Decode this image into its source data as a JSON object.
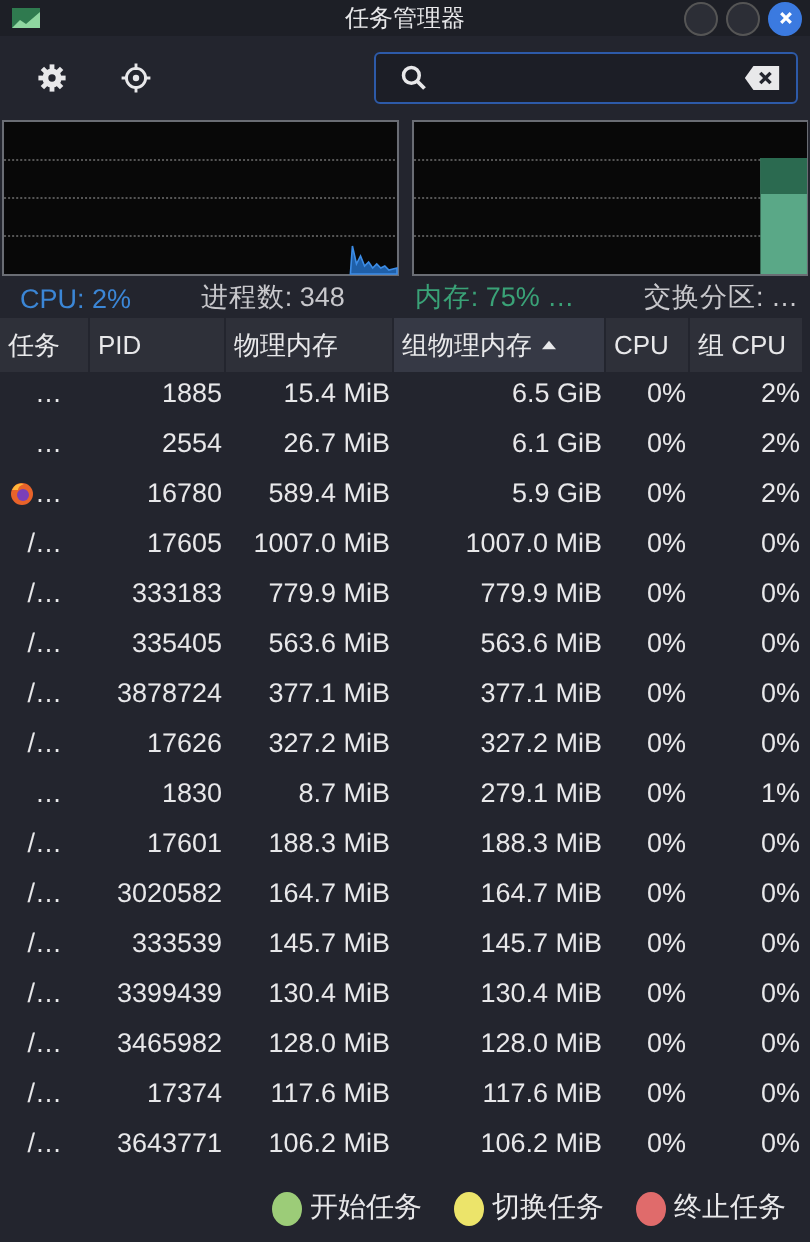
{
  "window": {
    "title": "任务管理器"
  },
  "stats": [
    {
      "text": "CPU: 2%",
      "kind": "cpu"
    },
    {
      "text": "进程数: 348",
      "kind": "plain"
    },
    {
      "text": "内存: 75% …",
      "kind": "memory"
    },
    {
      "text": "交换分区: …",
      "kind": "plain"
    }
  ],
  "table": {
    "columns": [
      {
        "label": "任务",
        "sorted": false
      },
      {
        "label": "PID",
        "sorted": false
      },
      {
        "label": "物理内存",
        "sorted": false
      },
      {
        "label": "组物理内存",
        "sorted": true
      },
      {
        "label": "CPU",
        "sorted": false
      },
      {
        "label": "组 CPU",
        "sorted": false
      }
    ],
    "rows": [
      {
        "task": "…",
        "icon": false,
        "pid": "1885",
        "memory": "15.4 MiB",
        "group_memory": "6.5 GiB",
        "cpu": "0%",
        "group_cpu": "2%"
      },
      {
        "task": "…",
        "icon": false,
        "pid": "2554",
        "memory": "26.7 MiB",
        "group_memory": "6.1 GiB",
        "cpu": "0%",
        "group_cpu": "2%"
      },
      {
        "task": "…",
        "icon": true,
        "pid": "16780",
        "memory": "589.4 MiB",
        "group_memory": "5.9 GiB",
        "cpu": "0%",
        "group_cpu": "2%"
      },
      {
        "task": "/…",
        "icon": false,
        "pid": "17605",
        "memory": "1007.0 MiB",
        "group_memory": "1007.0 MiB",
        "cpu": "0%",
        "group_cpu": "0%"
      },
      {
        "task": "/…",
        "icon": false,
        "pid": "333183",
        "memory": "779.9 MiB",
        "group_memory": "779.9 MiB",
        "cpu": "0%",
        "group_cpu": "0%"
      },
      {
        "task": "/…",
        "icon": false,
        "pid": "335405",
        "memory": "563.6 MiB",
        "group_memory": "563.6 MiB",
        "cpu": "0%",
        "group_cpu": "0%"
      },
      {
        "task": "/…",
        "icon": false,
        "pid": "3878724",
        "memory": "377.1 MiB",
        "group_memory": "377.1 MiB",
        "cpu": "0%",
        "group_cpu": "0%"
      },
      {
        "task": "/…",
        "icon": false,
        "pid": "17626",
        "memory": "327.2 MiB",
        "group_memory": "327.2 MiB",
        "cpu": "0%",
        "group_cpu": "0%"
      },
      {
        "task": "…",
        "icon": false,
        "pid": "1830",
        "memory": "8.7 MiB",
        "group_memory": "279.1 MiB",
        "cpu": "0%",
        "group_cpu": "1%"
      },
      {
        "task": "/…",
        "icon": false,
        "pid": "17601",
        "memory": "188.3 MiB",
        "group_memory": "188.3 MiB",
        "cpu": "0%",
        "group_cpu": "0%"
      },
      {
        "task": "/…",
        "icon": false,
        "pid": "3020582",
        "memory": "164.7 MiB",
        "group_memory": "164.7 MiB",
        "cpu": "0%",
        "group_cpu": "0%"
      },
      {
        "task": "/…",
        "icon": false,
        "pid": "333539",
        "memory": "145.7 MiB",
        "group_memory": "145.7 MiB",
        "cpu": "0%",
        "group_cpu": "0%"
      },
      {
        "task": "/…",
        "icon": false,
        "pid": "3399439",
        "memory": "130.4 MiB",
        "group_memory": "130.4 MiB",
        "cpu": "0%",
        "group_cpu": "0%"
      },
      {
        "task": "/…",
        "icon": false,
        "pid": "3465982",
        "memory": "128.0 MiB",
        "group_memory": "128.0 MiB",
        "cpu": "0%",
        "group_cpu": "0%"
      },
      {
        "task": "/…",
        "icon": false,
        "pid": "17374",
        "memory": "117.6 MiB",
        "group_memory": "117.6 MiB",
        "cpu": "0%",
        "group_cpu": "0%"
      },
      {
        "task": "/…",
        "icon": false,
        "pid": "3643771",
        "memory": "106.2 MiB",
        "group_memory": "106.2 MiB",
        "cpu": "0%",
        "group_cpu": "0%"
      }
    ]
  },
  "actions": [
    {
      "label": "开始任务",
      "color": "#9ccc78"
    },
    {
      "label": "切换任务",
      "color": "#ece46a"
    },
    {
      "label": "终止任务",
      "color": "#e06b6b"
    }
  ]
}
